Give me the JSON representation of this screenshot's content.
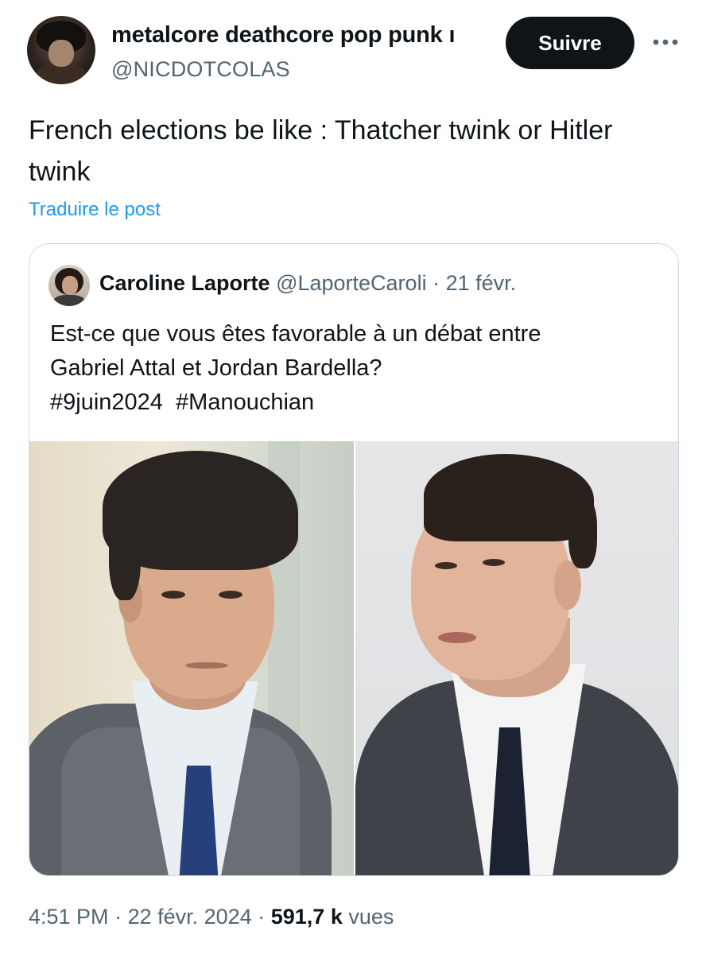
{
  "author": {
    "display_name": "metalcore deathcore pop punk ı",
    "handle": "@NICDOTCOLAS"
  },
  "follow_button": {
    "label": "Suivre"
  },
  "more_button": {
    "icon": "more-horizontal-icon"
  },
  "tweet": {
    "text": "French elections be like : Thatcher twink or Hitler twink",
    "translate_label": "Traduire le post"
  },
  "quote": {
    "display_name": "Caroline Laporte",
    "handle": "@LaporteCaroli",
    "separator": "·",
    "date": "21 févr.",
    "text_line1": "Est-ce que vous êtes favorable à un débat entre",
    "text_line2": "Gabriel Attal et Jordan Bardella?",
    "hashtags": [
      "#9juin2024",
      "#Manouchian"
    ]
  },
  "footer": {
    "time": "4:51 PM",
    "separator": "·",
    "date": "22 févr. 2024",
    "views_count": "591,7 k",
    "views_label": "vues"
  },
  "colors": {
    "text_primary": "#0f1419",
    "text_secondary": "#536471",
    "link": "#1d9bf0",
    "border": "#cfd9de",
    "button_bg": "#0f1419"
  }
}
